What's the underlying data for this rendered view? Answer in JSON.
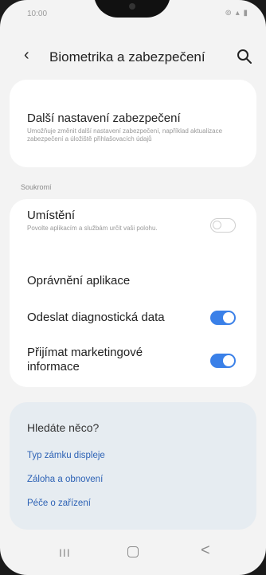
{
  "status_bar": {
    "time": "10:00",
    "icons": "⊚ ▴ ▮"
  },
  "header": {
    "back_icon": "‹",
    "title": "Biometrika a zabezpečení"
  },
  "card1": {
    "cut_text": "",
    "title": "Další nastavení zabezpečení",
    "description": "Umožňuje změnit další nastavení zabezpečení, například aktualizace zabezpečení a úložiště přihlašovacích údajů"
  },
  "section": {
    "privacy_label": "Soukromí"
  },
  "privacy": {
    "location": {
      "title": "Umístění",
      "description": "Povolte aplikacím a službám určit vaši polohu.",
      "enabled": false
    },
    "permissions": {
      "title": "Oprávnění aplikace"
    },
    "diagnostics": {
      "title": "Odeslat diagnostická data",
      "enabled": true
    },
    "marketing": {
      "title": "Přijímat marketingové informace",
      "enabled": true
    }
  },
  "help": {
    "title": "Hledáte něco?",
    "links": [
      "Typ zámku displeje",
      "Záloha a obnovení",
      "Péče o zařízení"
    ]
  },
  "nav": {
    "recents": "III",
    "back": "<"
  },
  "colors": {
    "accent": "#3a80e8",
    "link": "#2d62b5"
  }
}
